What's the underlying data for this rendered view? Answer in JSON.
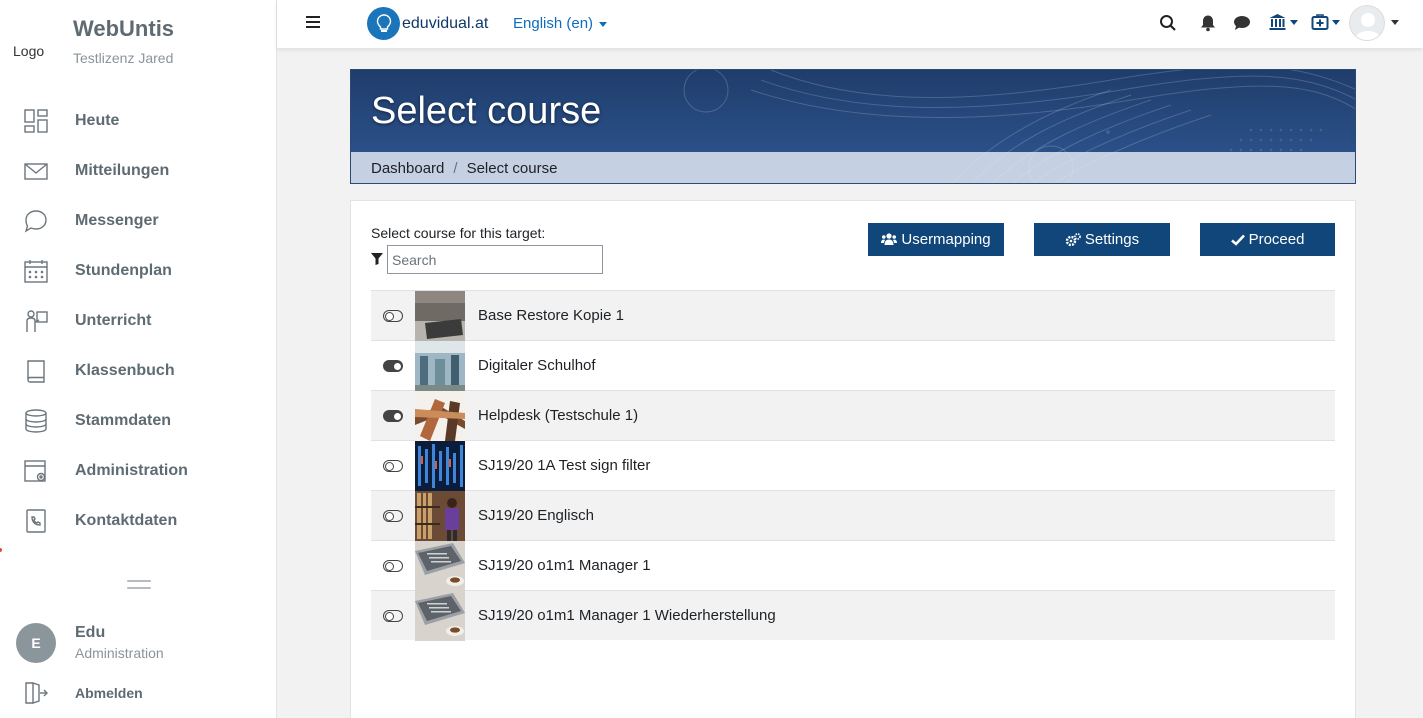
{
  "sidebar": {
    "logo_text": "Logo",
    "app_name": "WebUntis",
    "school": "Testlizenz Jared",
    "items": [
      {
        "label": "Heute",
        "icon": "dashboard-icon"
      },
      {
        "label": "Mitteilungen",
        "icon": "envelope-icon"
      },
      {
        "label": "Messenger",
        "icon": "chat-bubble-icon"
      },
      {
        "label": "Stundenplan",
        "icon": "calendar-icon"
      },
      {
        "label": "Unterricht",
        "icon": "teacher-icon"
      },
      {
        "label": "Klassenbuch",
        "icon": "book-icon"
      },
      {
        "label": "Stammdaten",
        "icon": "database-icon"
      },
      {
        "label": "Administration",
        "icon": "admin-gear-icon"
      },
      {
        "label": "Kontaktdaten",
        "icon": "contact-phone-icon"
      }
    ],
    "user": {
      "initial": "E",
      "name": "Edu",
      "role": "Administration"
    },
    "logout_label": "Abmelden"
  },
  "topbar": {
    "brand": "eduvidual.at",
    "language": "English (en)"
  },
  "header": {
    "title": "Select course",
    "breadcrumb": [
      "Dashboard",
      "Select course"
    ]
  },
  "main": {
    "select_label": "Select course for this target:",
    "search_placeholder": "Search",
    "buttons": {
      "usermapping": "Usermapping",
      "settings": "Settings",
      "proceed": "Proceed"
    },
    "courses": [
      {
        "name": "Base Restore Kopie 1",
        "enabled": false
      },
      {
        "name": "Digitaler Schulhof",
        "enabled": true
      },
      {
        "name": "Helpdesk (Testschule 1)",
        "enabled": true
      },
      {
        "name": "SJ19/20 1A Test sign filter",
        "enabled": false
      },
      {
        "name": "SJ19/20 Englisch",
        "enabled": false
      },
      {
        "name": "SJ19/20 o1m1 Manager 1",
        "enabled": false
      },
      {
        "name": "SJ19/20 o1m1 Manager 1 Wiederherstellung",
        "enabled": false
      }
    ]
  },
  "colors": {
    "primary_button": "#10467a",
    "banner": "#2f5794",
    "link": "#0f6cbf"
  }
}
